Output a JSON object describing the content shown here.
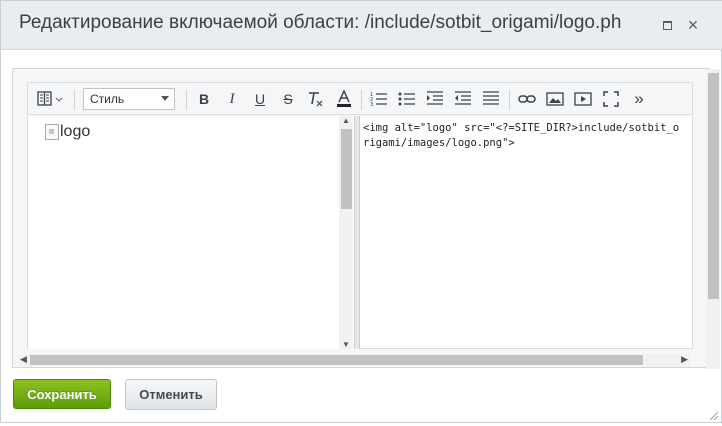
{
  "dialog": {
    "title": "Редактирование включаемой области: /include/sotbit_origami/logo.ph",
    "close_glyph": "×"
  },
  "toolbar": {
    "style_select_value": "Стиль",
    "icons": [
      "view-mode-icon",
      "bold-icon",
      "italic-icon",
      "underline-icon",
      "strikethrough-icon",
      "remove-format-icon",
      "text-color-icon",
      "ordered-list-icon",
      "unordered-list-icon",
      "indent-icon",
      "outdent-icon",
      "align-icon",
      "link-icon",
      "image-icon",
      "video-icon",
      "fullscreen-icon",
      "more-icon"
    ],
    "bold_glyph": "B",
    "italic_glyph": "I",
    "underline_glyph": "U",
    "strike_glyph": "S",
    "more_glyph": "»"
  },
  "editor": {
    "visual_img_alt": "logo",
    "source_code": "<img alt=\"logo\" src=\"<?=SITE_DIR?>include/sotbit_origami/images/logo.png\">"
  },
  "buttons": {
    "save_label": "Сохранить",
    "cancel_label": "Отменить"
  },
  "colors": {
    "save_button": "#6ba515",
    "titlebar_bg": "#e8eef0"
  }
}
